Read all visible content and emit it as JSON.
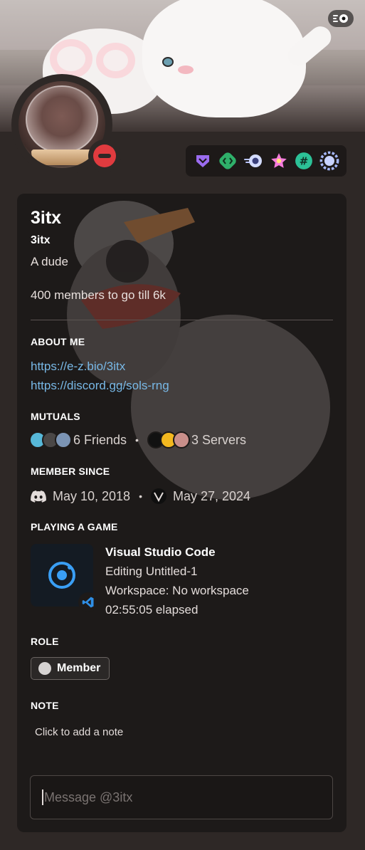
{
  "profile": {
    "display_name": "3itx",
    "username": "3itx",
    "pronouns": "A dude",
    "custom_status": "400 members to go till 6k",
    "status": "dnd",
    "status_color": "#e03b3f"
  },
  "badges": [
    {
      "name": "hypesquad-balance-icon",
      "color": "#9b6cf0"
    },
    {
      "name": "active-developer-icon",
      "color": "#2fb06a"
    },
    {
      "name": "nitro-boost-icon",
      "color": "#b9c4ff"
    },
    {
      "name": "quest-badge-icon",
      "color": "#f67bdc"
    },
    {
      "name": "originally-known-as-icon",
      "color": "#2cc197"
    },
    {
      "name": "server-boost-laurel-icon",
      "color": "#a7b9ff"
    }
  ],
  "about": {
    "title": "ABOUT ME",
    "links": [
      "https://e-z.bio/3itx",
      "https://discord.gg/sols-rng"
    ]
  },
  "mutuals": {
    "title": "MUTUALS",
    "friends": "6 Friends",
    "separator": "•",
    "servers": "3 Servers"
  },
  "member_since": {
    "title": "MEMBER SINCE",
    "discord_date": "May 10, 2018",
    "separator": "•",
    "server_date": "May 27, 2024"
  },
  "activity": {
    "title": "PLAYING A GAME",
    "name": "Visual Studio Code",
    "details": "Editing Untitled-1",
    "state": "Workspace: No workspace",
    "elapsed": "02:55:05 elapsed",
    "accent": "#3a9ff5"
  },
  "role": {
    "title": "ROLE",
    "name": "Member"
  },
  "note": {
    "title": "NOTE",
    "placeholder": "Click to add a note"
  },
  "message": {
    "placeholder": "Message @3itx"
  }
}
